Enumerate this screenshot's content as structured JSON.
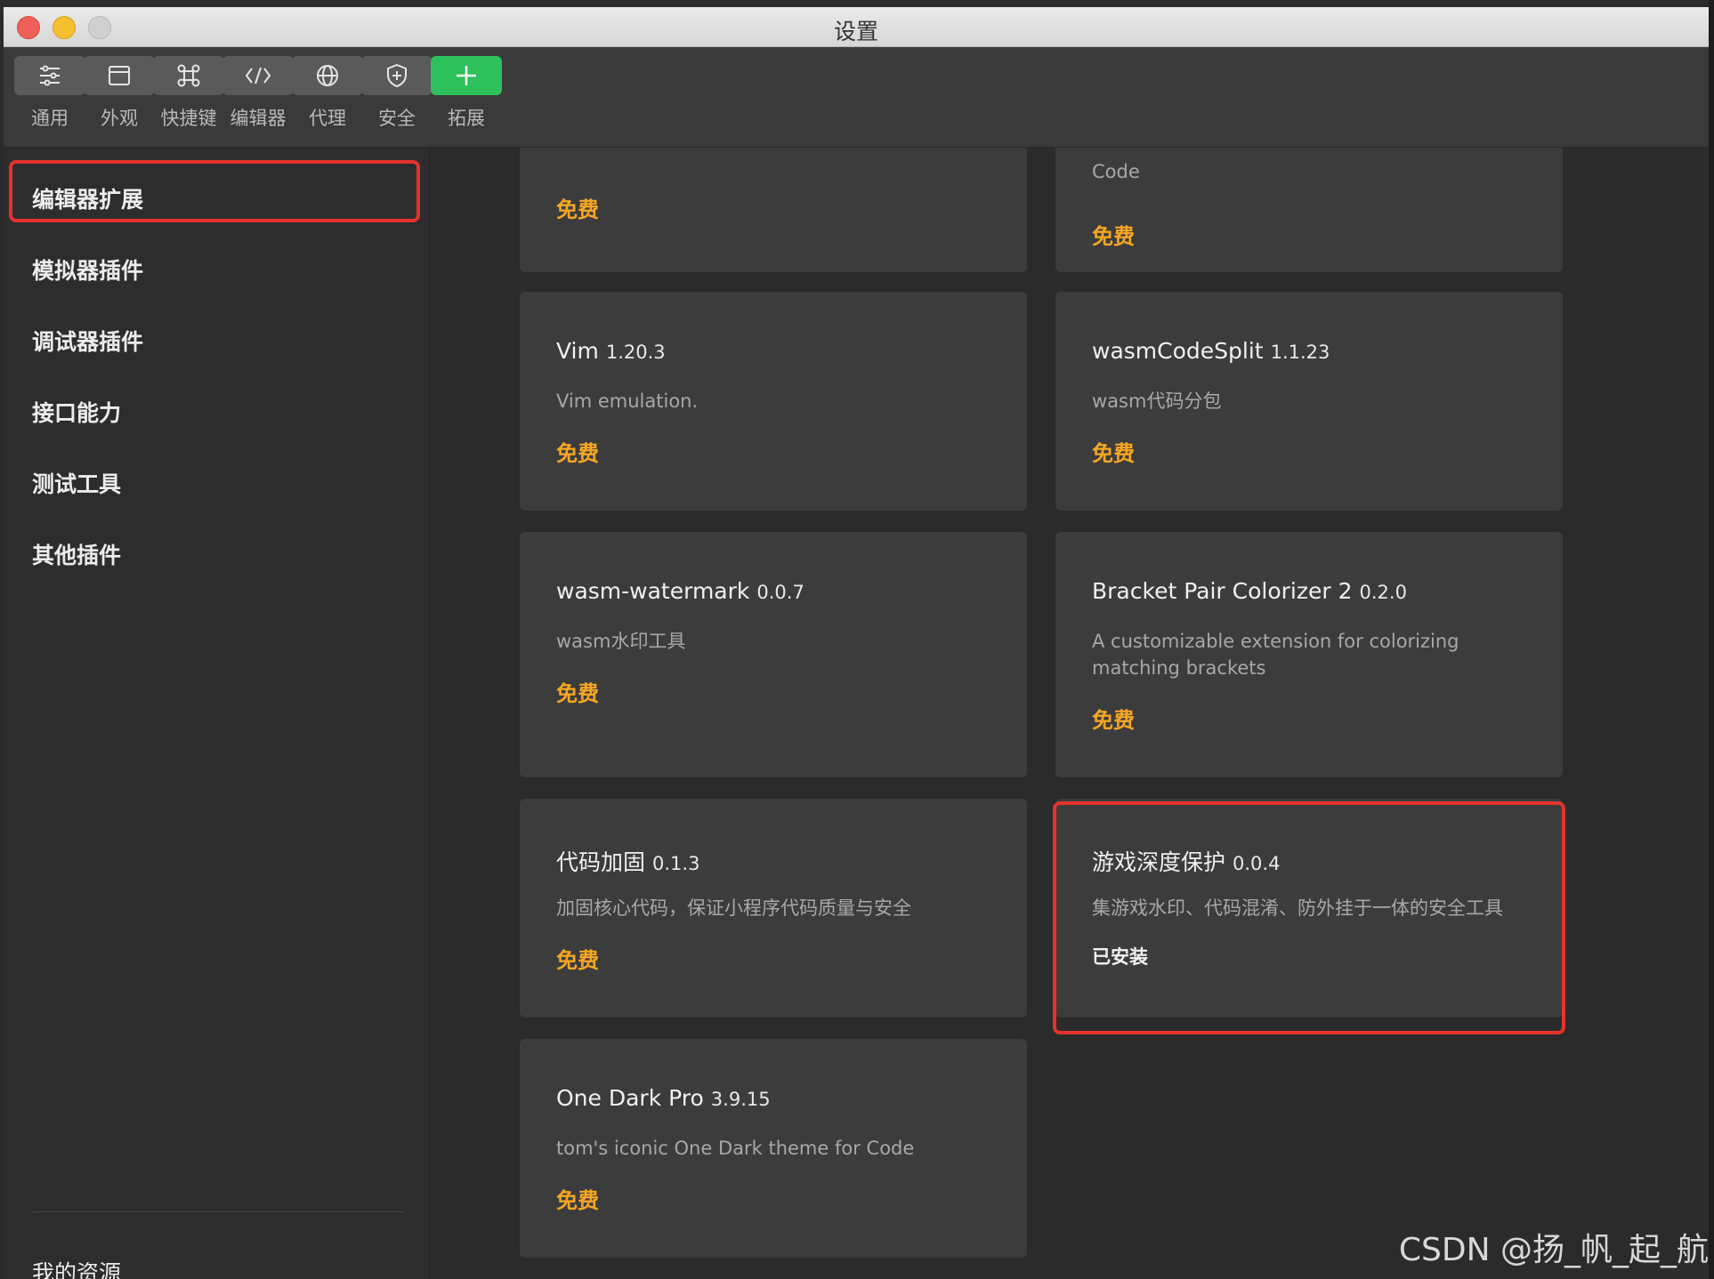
{
  "window": {
    "title": "设置"
  },
  "toolbar": {
    "items": [
      {
        "label": "通用",
        "icon": "sliders-icon"
      },
      {
        "label": "外观",
        "icon": "window-icon"
      },
      {
        "label": "快捷键",
        "icon": "command-key-icon"
      },
      {
        "label": "编辑器",
        "icon": "code-icon"
      },
      {
        "label": "代理",
        "icon": "globe-icon"
      },
      {
        "label": "安全",
        "icon": "shield-icon"
      },
      {
        "label": "拓展",
        "icon": "plus-icon"
      }
    ],
    "active_color": "#2ec05b"
  },
  "sidebar": {
    "items": [
      "编辑器扩展",
      "模拟器插件",
      "调试器插件",
      "接口能力",
      "测试工具",
      "其他插件"
    ],
    "selected": "编辑器扩展",
    "footer": "我的资源"
  },
  "extensions": [
    {
      "desc": "Code",
      "price": "免费"
    },
    {
      "price": "免费"
    },
    {
      "name": "Vim",
      "version": "1.20.3",
      "desc": "Vim emulation.",
      "price": "免费"
    },
    {
      "name": "wasmCodeSplit",
      "version": "1.1.23",
      "desc": "wasm代码分包",
      "price": "免费"
    },
    {
      "name": "wasm-watermark",
      "version": "0.0.7",
      "desc": "wasm水印工具",
      "price": "免费"
    },
    {
      "name": "Bracket Pair Colorizer 2",
      "version": "0.2.0",
      "desc": "A customizable extension for colorizing matching brackets",
      "price": "免费"
    },
    {
      "name": "代码加固",
      "version": "0.1.3",
      "desc": "加固核心代码，保证小程序代码质量与安全",
      "price": "免费"
    },
    {
      "name": "游戏深度保护",
      "version": "0.0.4",
      "desc": "集游戏水印、代码混淆、防外挂于一体的安全工具",
      "status": "已安装"
    },
    {
      "name": "One Dark Pro",
      "version": "3.9.15",
      "desc": "tom's iconic One Dark theme for Code",
      "price": "免费"
    }
  ],
  "colors": {
    "price": "#f5a623",
    "highlight": "#e5322d"
  },
  "watermark": "CSDN @扬_帆_起_航"
}
